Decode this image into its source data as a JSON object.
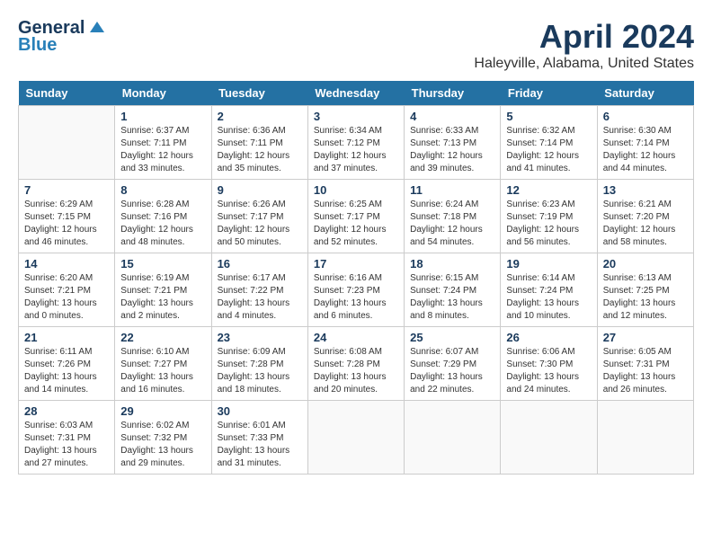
{
  "header": {
    "logo_line1": "General",
    "logo_line2": "Blue",
    "month": "April 2024",
    "location": "Haleyville, Alabama, United States"
  },
  "weekdays": [
    "Sunday",
    "Monday",
    "Tuesday",
    "Wednesday",
    "Thursday",
    "Friday",
    "Saturday"
  ],
  "weeks": [
    [
      {
        "day": "",
        "info": ""
      },
      {
        "day": "1",
        "info": "Sunrise: 6:37 AM\nSunset: 7:11 PM\nDaylight: 12 hours\nand 33 minutes."
      },
      {
        "day": "2",
        "info": "Sunrise: 6:36 AM\nSunset: 7:11 PM\nDaylight: 12 hours\nand 35 minutes."
      },
      {
        "day": "3",
        "info": "Sunrise: 6:34 AM\nSunset: 7:12 PM\nDaylight: 12 hours\nand 37 minutes."
      },
      {
        "day": "4",
        "info": "Sunrise: 6:33 AM\nSunset: 7:13 PM\nDaylight: 12 hours\nand 39 minutes."
      },
      {
        "day": "5",
        "info": "Sunrise: 6:32 AM\nSunset: 7:14 PM\nDaylight: 12 hours\nand 41 minutes."
      },
      {
        "day": "6",
        "info": "Sunrise: 6:30 AM\nSunset: 7:14 PM\nDaylight: 12 hours\nand 44 minutes."
      }
    ],
    [
      {
        "day": "7",
        "info": "Sunrise: 6:29 AM\nSunset: 7:15 PM\nDaylight: 12 hours\nand 46 minutes."
      },
      {
        "day": "8",
        "info": "Sunrise: 6:28 AM\nSunset: 7:16 PM\nDaylight: 12 hours\nand 48 minutes."
      },
      {
        "day": "9",
        "info": "Sunrise: 6:26 AM\nSunset: 7:17 PM\nDaylight: 12 hours\nand 50 minutes."
      },
      {
        "day": "10",
        "info": "Sunrise: 6:25 AM\nSunset: 7:17 PM\nDaylight: 12 hours\nand 52 minutes."
      },
      {
        "day": "11",
        "info": "Sunrise: 6:24 AM\nSunset: 7:18 PM\nDaylight: 12 hours\nand 54 minutes."
      },
      {
        "day": "12",
        "info": "Sunrise: 6:23 AM\nSunset: 7:19 PM\nDaylight: 12 hours\nand 56 minutes."
      },
      {
        "day": "13",
        "info": "Sunrise: 6:21 AM\nSunset: 7:20 PM\nDaylight: 12 hours\nand 58 minutes."
      }
    ],
    [
      {
        "day": "14",
        "info": "Sunrise: 6:20 AM\nSunset: 7:21 PM\nDaylight: 13 hours\nand 0 minutes."
      },
      {
        "day": "15",
        "info": "Sunrise: 6:19 AM\nSunset: 7:21 PM\nDaylight: 13 hours\nand 2 minutes."
      },
      {
        "day": "16",
        "info": "Sunrise: 6:17 AM\nSunset: 7:22 PM\nDaylight: 13 hours\nand 4 minutes."
      },
      {
        "day": "17",
        "info": "Sunrise: 6:16 AM\nSunset: 7:23 PM\nDaylight: 13 hours\nand 6 minutes."
      },
      {
        "day": "18",
        "info": "Sunrise: 6:15 AM\nSunset: 7:24 PM\nDaylight: 13 hours\nand 8 minutes."
      },
      {
        "day": "19",
        "info": "Sunrise: 6:14 AM\nSunset: 7:24 PM\nDaylight: 13 hours\nand 10 minutes."
      },
      {
        "day": "20",
        "info": "Sunrise: 6:13 AM\nSunset: 7:25 PM\nDaylight: 13 hours\nand 12 minutes."
      }
    ],
    [
      {
        "day": "21",
        "info": "Sunrise: 6:11 AM\nSunset: 7:26 PM\nDaylight: 13 hours\nand 14 minutes."
      },
      {
        "day": "22",
        "info": "Sunrise: 6:10 AM\nSunset: 7:27 PM\nDaylight: 13 hours\nand 16 minutes."
      },
      {
        "day": "23",
        "info": "Sunrise: 6:09 AM\nSunset: 7:28 PM\nDaylight: 13 hours\nand 18 minutes."
      },
      {
        "day": "24",
        "info": "Sunrise: 6:08 AM\nSunset: 7:28 PM\nDaylight: 13 hours\nand 20 minutes."
      },
      {
        "day": "25",
        "info": "Sunrise: 6:07 AM\nSunset: 7:29 PM\nDaylight: 13 hours\nand 22 minutes."
      },
      {
        "day": "26",
        "info": "Sunrise: 6:06 AM\nSunset: 7:30 PM\nDaylight: 13 hours\nand 24 minutes."
      },
      {
        "day": "27",
        "info": "Sunrise: 6:05 AM\nSunset: 7:31 PM\nDaylight: 13 hours\nand 26 minutes."
      }
    ],
    [
      {
        "day": "28",
        "info": "Sunrise: 6:03 AM\nSunset: 7:31 PM\nDaylight: 13 hours\nand 27 minutes."
      },
      {
        "day": "29",
        "info": "Sunrise: 6:02 AM\nSunset: 7:32 PM\nDaylight: 13 hours\nand 29 minutes."
      },
      {
        "day": "30",
        "info": "Sunrise: 6:01 AM\nSunset: 7:33 PM\nDaylight: 13 hours\nand 31 minutes."
      },
      {
        "day": "",
        "info": ""
      },
      {
        "day": "",
        "info": ""
      },
      {
        "day": "",
        "info": ""
      },
      {
        "day": "",
        "info": ""
      }
    ]
  ]
}
